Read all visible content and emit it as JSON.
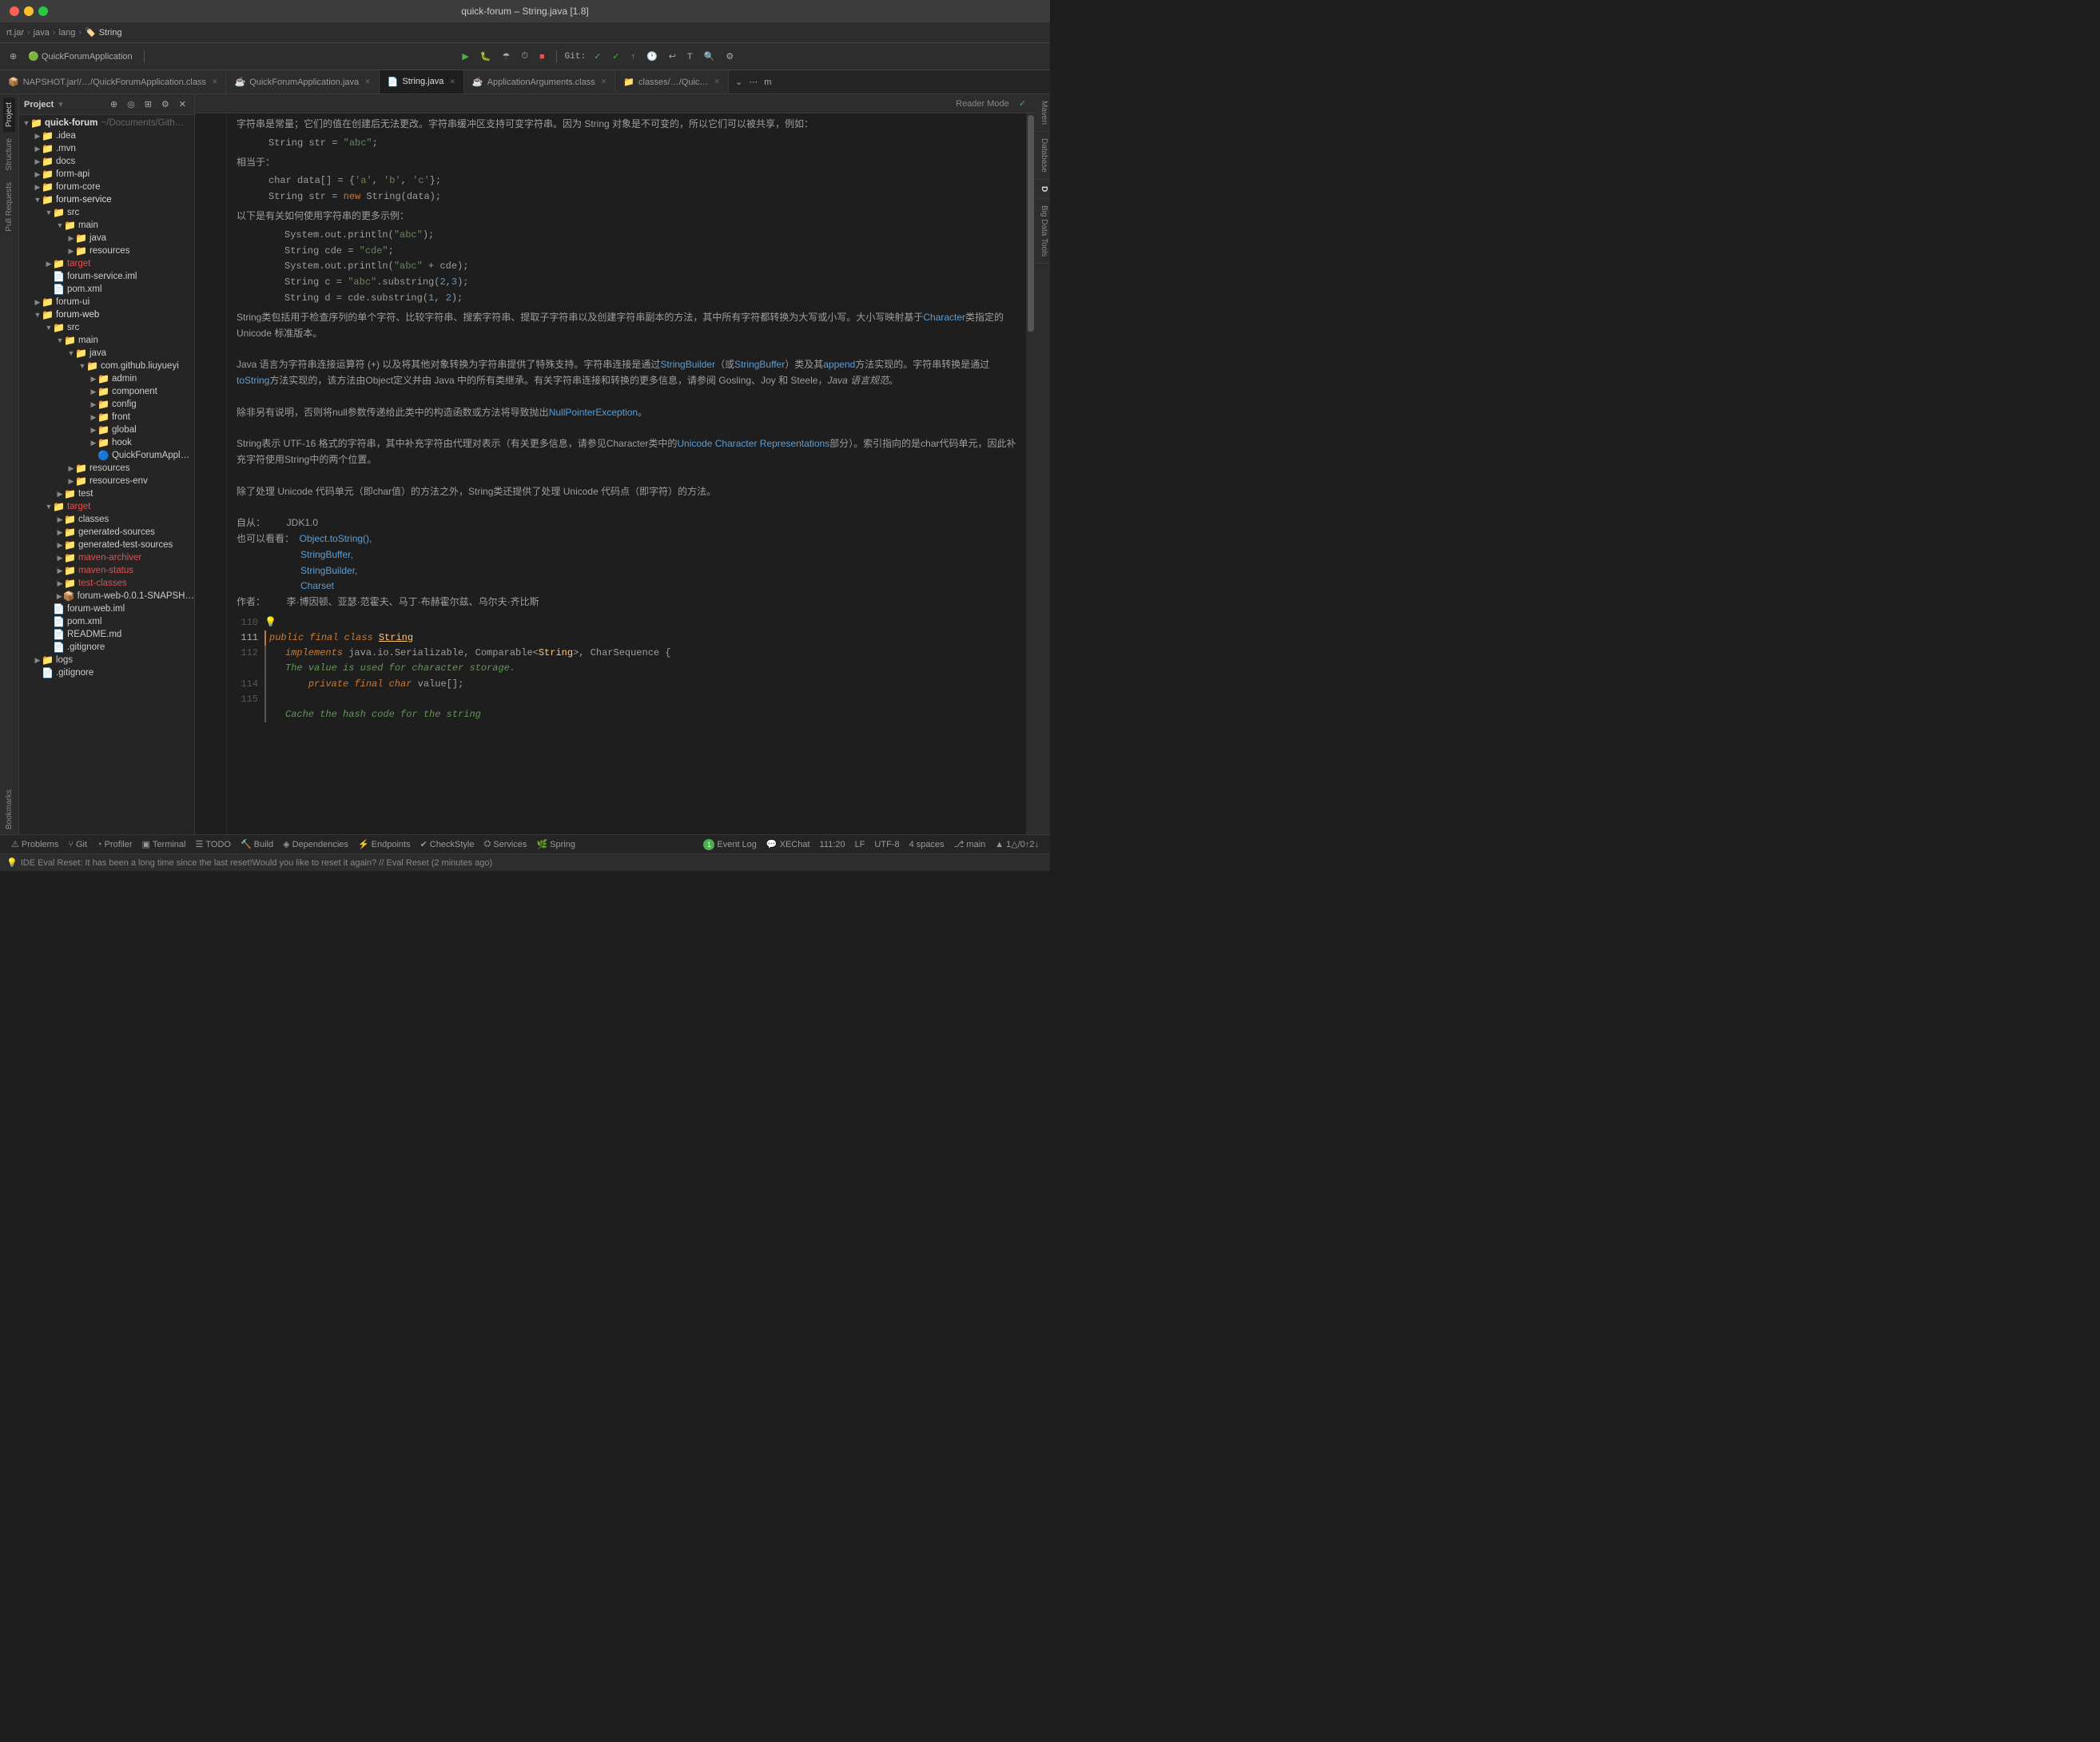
{
  "window": {
    "title": "quick-forum – String.java [1.8]",
    "traffic_lights": [
      "red",
      "yellow",
      "green"
    ]
  },
  "breadcrumb": {
    "items": [
      "rt.jar",
      "java",
      "lang",
      "String"
    ]
  },
  "toolbar": {
    "run_app_label": "QuickForumApplication",
    "git_label": "Git:",
    "main_branch": "⎇ main"
  },
  "tabs": [
    {
      "id": "tab1",
      "icon": "📦",
      "label": "NAPSHOT.jar!/…/QuickForumApplication.class",
      "active": false
    },
    {
      "id": "tab2",
      "icon": "☕",
      "label": "QuickForumApplication.java",
      "active": false
    },
    {
      "id": "tab3",
      "icon": "📄",
      "label": "String.java",
      "active": true
    },
    {
      "id": "tab4",
      "icon": "☕",
      "label": "ApplicationArguments.class",
      "active": false
    },
    {
      "id": "tab5",
      "icon": "📁",
      "label": "classes/…/Quic…",
      "active": false
    }
  ],
  "sidebar": {
    "header": "Project",
    "tree": [
      {
        "level": 0,
        "icon": "📁",
        "label": "quick-forum",
        "suffix": "~/Documents/Gith…",
        "expanded": true,
        "type": "folder"
      },
      {
        "level": 1,
        "icon": "📁",
        "label": ".idea",
        "expanded": false,
        "type": "folder"
      },
      {
        "level": 1,
        "icon": "📁",
        "label": ".mvn",
        "expanded": false,
        "type": "folder"
      },
      {
        "level": 1,
        "icon": "📁",
        "label": "docs",
        "expanded": false,
        "type": "folder"
      },
      {
        "level": 1,
        "icon": "📁",
        "label": "form-api",
        "expanded": false,
        "type": "folder"
      },
      {
        "level": 1,
        "icon": "📁",
        "label": "forum-core",
        "expanded": false,
        "type": "folder"
      },
      {
        "level": 1,
        "icon": "📁",
        "label": "forum-service",
        "expanded": true,
        "type": "folder"
      },
      {
        "level": 2,
        "icon": "📁",
        "label": "src",
        "expanded": true,
        "type": "folder"
      },
      {
        "level": 3,
        "icon": "📁",
        "label": "main",
        "expanded": true,
        "type": "folder"
      },
      {
        "level": 4,
        "icon": "📁",
        "label": "java",
        "expanded": false,
        "type": "folder"
      },
      {
        "level": 4,
        "icon": "📁",
        "label": "resources",
        "expanded": false,
        "type": "folder"
      },
      {
        "level": 2,
        "icon": "📁",
        "label": "target",
        "expanded": false,
        "type": "folder",
        "color": "red"
      },
      {
        "level": 2,
        "icon": "📄",
        "label": "forum-service.iml",
        "type": "iml"
      },
      {
        "level": 2,
        "icon": "📄",
        "label": "pom.xml",
        "type": "xml"
      },
      {
        "level": 1,
        "icon": "📁",
        "label": "forum-ui",
        "expanded": false,
        "type": "folder"
      },
      {
        "level": 1,
        "icon": "📁",
        "label": "forum-web",
        "expanded": true,
        "type": "folder"
      },
      {
        "level": 2,
        "icon": "📁",
        "label": "src",
        "expanded": true,
        "type": "folder"
      },
      {
        "level": 3,
        "icon": "📁",
        "label": "main",
        "expanded": true,
        "type": "folder"
      },
      {
        "level": 4,
        "icon": "📁",
        "label": "java",
        "expanded": true,
        "type": "folder"
      },
      {
        "level": 5,
        "icon": "📁",
        "label": "com.github.liuyueyi",
        "expanded": true,
        "type": "folder"
      },
      {
        "level": 6,
        "icon": "📁",
        "label": "admin",
        "expanded": false,
        "type": "folder"
      },
      {
        "level": 6,
        "icon": "📁",
        "label": "component",
        "expanded": false,
        "type": "folder"
      },
      {
        "level": 6,
        "icon": "📁",
        "label": "config",
        "expanded": false,
        "type": "folder"
      },
      {
        "level": 6,
        "icon": "📁",
        "label": "front",
        "expanded": false,
        "type": "folder"
      },
      {
        "level": 6,
        "icon": "📁",
        "label": "global",
        "expanded": false,
        "type": "folder"
      },
      {
        "level": 6,
        "icon": "📁",
        "label": "hook",
        "expanded": false,
        "type": "folder"
      },
      {
        "level": 6,
        "icon": "🔵",
        "label": "QuickForumAppl…",
        "type": "java"
      },
      {
        "level": 4,
        "icon": "📁",
        "label": "resources",
        "expanded": false,
        "type": "folder"
      },
      {
        "level": 4,
        "icon": "📁",
        "label": "resources-env",
        "expanded": false,
        "type": "folder"
      },
      {
        "level": 3,
        "icon": "📁",
        "label": "test",
        "expanded": false,
        "type": "folder"
      },
      {
        "level": 2,
        "icon": "📁",
        "label": "target",
        "expanded": true,
        "type": "folder",
        "color": "red"
      },
      {
        "level": 3,
        "icon": "📁",
        "label": "classes",
        "expanded": false,
        "type": "folder"
      },
      {
        "level": 3,
        "icon": "📁",
        "label": "generated-sources",
        "expanded": false,
        "type": "folder"
      },
      {
        "level": 3,
        "icon": "📁",
        "label": "generated-test-sources",
        "expanded": false,
        "type": "folder"
      },
      {
        "level": 3,
        "icon": "📁",
        "label": "maven-archiver",
        "expanded": false,
        "type": "folder",
        "color": "red"
      },
      {
        "level": 3,
        "icon": "📁",
        "label": "maven-status",
        "expanded": false,
        "type": "folder",
        "color": "red"
      },
      {
        "level": 3,
        "icon": "📁",
        "label": "test-classes",
        "expanded": false,
        "type": "folder",
        "color": "red"
      },
      {
        "level": 3,
        "icon": "📦",
        "label": "forum-web-0.0.1-SNAPSH…",
        "type": "jar"
      },
      {
        "level": 2,
        "icon": "📄",
        "label": "forum-web.iml",
        "type": "iml"
      },
      {
        "level": 2,
        "icon": "📄",
        "label": "pom.xml",
        "type": "xml"
      },
      {
        "level": 2,
        "icon": "📄",
        "label": "README.md",
        "type": "md"
      },
      {
        "level": 2,
        "icon": "📄",
        "label": ".gitignore",
        "type": "file"
      },
      {
        "level": 1,
        "icon": "📁",
        "label": "logs",
        "expanded": false,
        "type": "folder"
      }
    ]
  },
  "vertical_tabs_left": [
    "Project",
    "Structure",
    "Pull Requests",
    "Bookmarks"
  ],
  "vertical_tabs_right": [
    "Maven",
    "Database",
    "D",
    "Big Data Tools"
  ],
  "reader_mode": "Reader Mode",
  "editor": {
    "doc_lines": [
      "字符串是常量；它们的值在创建后无法更改。字符串缓冲区支持可变字符串。因为 String 对象是不可变的，所以它们可以被共享，例如：",
      "",
      "        String str = \"abc\";",
      "",
      "相当于：",
      "",
      "        char data[] = {'a', 'b', 'c'};",
      "        String str = new String(data);",
      "",
      "以下是有关如何使用字符串的更多示例：",
      "",
      "            System.out.println(\"abc\");",
      "            String cde = \"cde\";",
      "            System.out.println(\"abc\" + cde);",
      "            String c = \"abc\".substring(2,3);",
      "            String d = cde.substring(1, 2);",
      "",
      "String类包括用于检查序列的单个字符、比较字符串、搜索字符串、提取子字符串以及创建字符串副本的方法，其中所有字符都转换为大写或小写。大小写映射基于Character类指定的 Unicode 标准版本。",
      "",
      "Java 语言为字符串连接运算符 (+) 以及将其他对象转换为字符串提供了特殊支持。字符串连接是通过StringBuilder（或StringBuffer）类及其append方法实现的。字符串转换是通过toString方法实现的，该方法由Object定义并由 Java 中的所有类继承。有关字符串连接和转换的更多信息，请参阅 Gosling、Joy 和 Steele，Java 语言规范。",
      "",
      "除非另有说明，否则将null参数传递给此类中的构造函数或方法将导致抛出NullPointerException。",
      "",
      "String表示 UTF-16 格式的字符串，其中补充字符由代理对表示（有关更多信息，请参见Character类中的Unicode Character Representations部分）。索引指向的是char代码单元，因此补充字符使用String中的两个位置。",
      "",
      "除了处理 Unicode 代码单元（即char值）的方法之外，String类还提供了处理 Unicode 代码点（即字符）的方法。",
      "",
      "自从：        JDK1.0",
      "也可以看看：  Object.toString(),",
      "             StringBuffer,",
      "             StringBuilder,",
      "             Charset",
      "作者：        李·博因顿、亚瑟·范霍夫、马丁·布赫霍尔兹、乌尔夫·齐比斯"
    ],
    "line_numbers": [
      "110",
      "111",
      "112",
      "",
      "114",
      "115"
    ],
    "code_lines": [
      {
        "ln": "110",
        "content": "",
        "type": "blank",
        "bulb": true
      },
      {
        "ln": "111",
        "content": "public final class String",
        "type": "class_decl"
      },
      {
        "ln": "112",
        "content": "    implements java.io.Serializable, Comparable<String>, CharSequence {",
        "type": "implements"
      },
      {
        "ln": "",
        "content": "    The value is used for character storage.",
        "type": "comment"
      },
      {
        "ln": "114",
        "content": "    private final char value[];",
        "type": "field"
      },
      {
        "ln": "115",
        "content": "",
        "type": "blank"
      },
      {
        "ln": "",
        "content": "    Cache the hash code for the string",
        "type": "comment_tail"
      }
    ]
  },
  "statusbar": {
    "problems": "Problems",
    "git": "Git",
    "profiler": "Profiler",
    "terminal": "Terminal",
    "todo": "TODO",
    "build": "Build",
    "dependencies": "Dependencies",
    "endpoints": "Endpoints",
    "checkstyle": "CheckStyle",
    "services": "Services",
    "spring": "Spring",
    "event_log": "Event Log",
    "xchat": "XEChat",
    "position": "111:20",
    "line_sep": "LF",
    "encoding": "UTF-8",
    "indent": "4 spaces",
    "branch": "⎇ main",
    "warnings": "▲ 1△/0↑2↓"
  },
  "notification": {
    "icon": "💡",
    "text": "IDE Eval Reset: It has been a long time since the last reset!Would you like to reset it again? // Eval Reset (2 minutes ago)"
  }
}
